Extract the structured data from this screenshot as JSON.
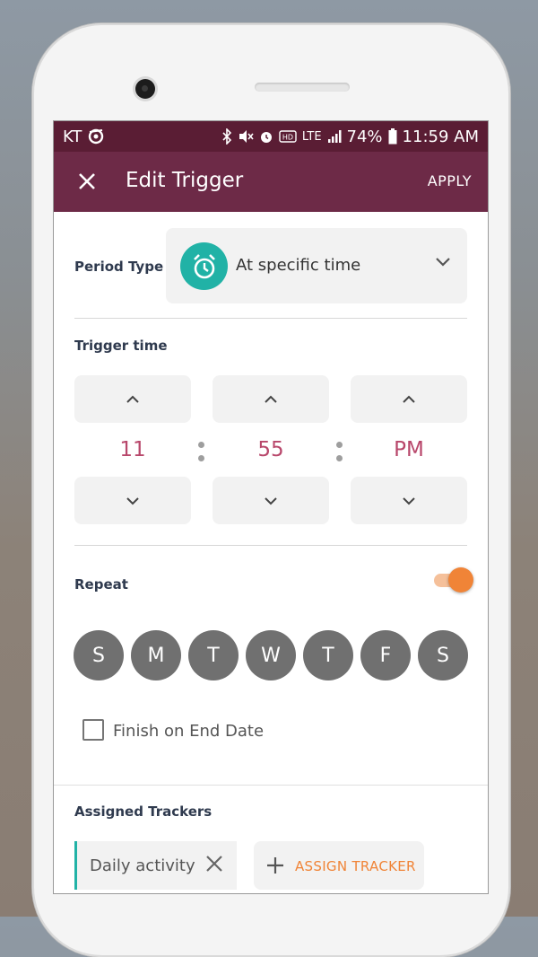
{
  "statusbar": {
    "carrier": "KT",
    "lte": "LTE",
    "battery": "74%",
    "time": "11:59 AM"
  },
  "appbar": {
    "title": "Edit Trigger",
    "apply_label": "APPLY"
  },
  "period": {
    "label": "Period Type",
    "value": "At specific time"
  },
  "trigger_time": {
    "label": "Trigger time",
    "hour": "11",
    "minute": "55",
    "ampm": "PM"
  },
  "repeat": {
    "label": "Repeat",
    "enabled": true,
    "days": [
      "S",
      "M",
      "T",
      "W",
      "T",
      "F",
      "S"
    ]
  },
  "finish_on_end_date": {
    "label": "Finish on End Date",
    "checked": false
  },
  "trackers": {
    "label": "Assigned Trackers",
    "items": [
      "Daily activity"
    ],
    "assign_label": "ASSIGN TRACKER"
  },
  "colors": {
    "status_bar": "#5a1d34",
    "app_bar": "#6d2a47",
    "accent_teal": "#21b2a6",
    "accent_orange": "#f08437",
    "time_value": "#b8476b"
  }
}
